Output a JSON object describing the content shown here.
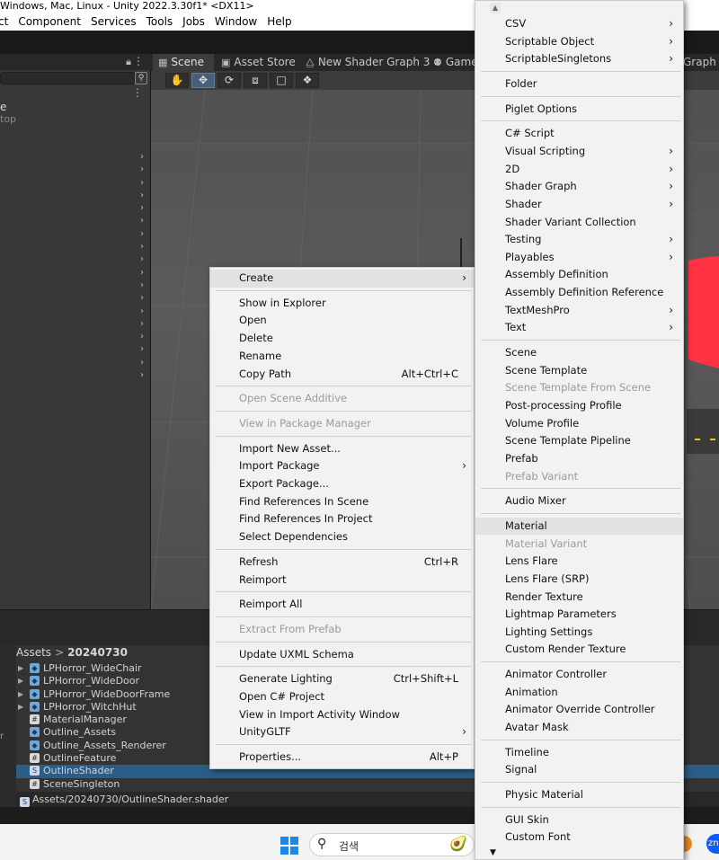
{
  "window": {
    "title": "Windows, Mac, Linux - Unity 2022.3.30f1* <DX11>"
  },
  "menubar": [
    "ct",
    "Component",
    "Services",
    "Tools",
    "Jobs",
    "Window",
    "Help"
  ],
  "hierarchy": {
    "lock_icon": "lock-icon",
    "item_partial": "e",
    "item_partial2": "top"
  },
  "scene_tabs": [
    {
      "label": "Scene",
      "icon": "hash-icon"
    },
    {
      "label": "Asset Store",
      "icon": "store-icon"
    },
    {
      "label": "New Shader Graph 3",
      "icon": "graph-icon"
    },
    {
      "label": "Game",
      "icon": "gamepad-icon"
    },
    {
      "label": "Graph",
      "icon": ""
    }
  ],
  "scene_tools": [
    "hand-tool",
    "move-tool",
    "rotate-tool",
    "scale-tool",
    "rect-tool",
    "transform-tool"
  ],
  "project": {
    "breadcrumb": [
      "Assets",
      "20240730"
    ],
    "items": [
      {
        "name": "LPHorror_WideChair",
        "type": "prefab",
        "expandable": true
      },
      {
        "name": "LPHorror_WideDoor",
        "type": "prefab",
        "expandable": true
      },
      {
        "name": "LPHorror_WideDoorFrame",
        "type": "prefab",
        "expandable": true
      },
      {
        "name": "LPHorror_WitchHut",
        "type": "prefab",
        "expandable": true
      },
      {
        "name": "MaterialManager",
        "type": "script",
        "expandable": false
      },
      {
        "name": "Outline_Assets",
        "type": "prefab",
        "expandable": false
      },
      {
        "name": "Outline_Assets_Renderer",
        "type": "prefab",
        "expandable": false
      },
      {
        "name": "OutlineFeature",
        "type": "script",
        "expandable": false
      },
      {
        "name": "OutlineShader",
        "type": "shader",
        "expandable": false,
        "selected": true
      },
      {
        "name": "SceneSingleton",
        "type": "script",
        "expandable": false
      }
    ],
    "path": "Assets/20240730/OutlineShader.shader"
  },
  "taskbar": {
    "search_placeholder": "검색"
  },
  "context_menu": [
    {
      "label": "Create",
      "submenu": true,
      "highlighted": true
    },
    {
      "sep": true
    },
    {
      "label": "Show in Explorer"
    },
    {
      "label": "Open"
    },
    {
      "label": "Delete"
    },
    {
      "label": "Rename"
    },
    {
      "label": "Copy Path",
      "shortcut": "Alt+Ctrl+C"
    },
    {
      "sep": true
    },
    {
      "label": "Open Scene Additive",
      "disabled": true
    },
    {
      "sep": true
    },
    {
      "label": "View in Package Manager",
      "disabled": true
    },
    {
      "sep": true
    },
    {
      "label": "Import New Asset..."
    },
    {
      "label": "Import Package",
      "submenu": true
    },
    {
      "label": "Export Package..."
    },
    {
      "label": "Find References In Scene"
    },
    {
      "label": "Find References In Project"
    },
    {
      "label": "Select Dependencies"
    },
    {
      "sep": true
    },
    {
      "label": "Refresh",
      "shortcut": "Ctrl+R"
    },
    {
      "label": "Reimport"
    },
    {
      "sep": true
    },
    {
      "label": "Reimport All"
    },
    {
      "sep": true
    },
    {
      "label": "Extract From Prefab",
      "disabled": true
    },
    {
      "sep": true
    },
    {
      "label": "Update UXML Schema"
    },
    {
      "sep": true
    },
    {
      "label": "Generate Lighting",
      "shortcut": "Ctrl+Shift+L"
    },
    {
      "label": "Open C# Project"
    },
    {
      "label": "View in Import Activity Window"
    },
    {
      "label": "UnityGLTF",
      "submenu": true
    },
    {
      "sep": true
    },
    {
      "label": "Properties...",
      "shortcut": "Alt+P"
    }
  ],
  "create_submenu": [
    {
      "label": "CSV",
      "submenu": true
    },
    {
      "label": "Scriptable Object",
      "submenu": true
    },
    {
      "label": "ScriptableSingletons",
      "submenu": true
    },
    {
      "sep": true
    },
    {
      "label": "Folder"
    },
    {
      "sep": true
    },
    {
      "label": "Piglet Options"
    },
    {
      "sep": true
    },
    {
      "label": "C# Script"
    },
    {
      "label": "Visual Scripting",
      "submenu": true
    },
    {
      "label": "2D",
      "submenu": true
    },
    {
      "label": "Shader Graph",
      "submenu": true
    },
    {
      "label": "Shader",
      "submenu": true
    },
    {
      "label": "Shader Variant Collection"
    },
    {
      "label": "Testing",
      "submenu": true
    },
    {
      "label": "Playables",
      "submenu": true
    },
    {
      "label": "Assembly Definition"
    },
    {
      "label": "Assembly Definition Reference"
    },
    {
      "label": "TextMeshPro",
      "submenu": true
    },
    {
      "label": "Text",
      "submenu": true
    },
    {
      "sep": true
    },
    {
      "label": "Scene"
    },
    {
      "label": "Scene Template"
    },
    {
      "label": "Scene Template From Scene",
      "disabled": true
    },
    {
      "label": "Post-processing Profile"
    },
    {
      "label": "Volume Profile"
    },
    {
      "label": "Scene Template Pipeline"
    },
    {
      "label": "Prefab"
    },
    {
      "label": "Prefab Variant",
      "disabled": true
    },
    {
      "sep": true
    },
    {
      "label": "Audio Mixer"
    },
    {
      "sep": true
    },
    {
      "label": "Material",
      "highlighted": true
    },
    {
      "label": "Material Variant",
      "disabled": true
    },
    {
      "label": "Lens Flare"
    },
    {
      "label": "Lens Flare (SRP)"
    },
    {
      "label": "Render Texture"
    },
    {
      "label": "Lightmap Parameters"
    },
    {
      "label": "Lighting Settings"
    },
    {
      "label": "Custom Render Texture"
    },
    {
      "sep": true
    },
    {
      "label": "Animator Controller"
    },
    {
      "label": "Animation"
    },
    {
      "label": "Animator Override Controller"
    },
    {
      "label": "Avatar Mask"
    },
    {
      "sep": true
    },
    {
      "label": "Timeline"
    },
    {
      "label": "Signal"
    },
    {
      "sep": true
    },
    {
      "label": "Physic Material"
    },
    {
      "sep": true
    },
    {
      "label": "GUI Skin"
    },
    {
      "label": "Custom Font"
    }
  ],
  "colors": {
    "selection": "#2c5d87",
    "scene_red": "#ff3344",
    "menu_bg": "#f2f2f2"
  }
}
